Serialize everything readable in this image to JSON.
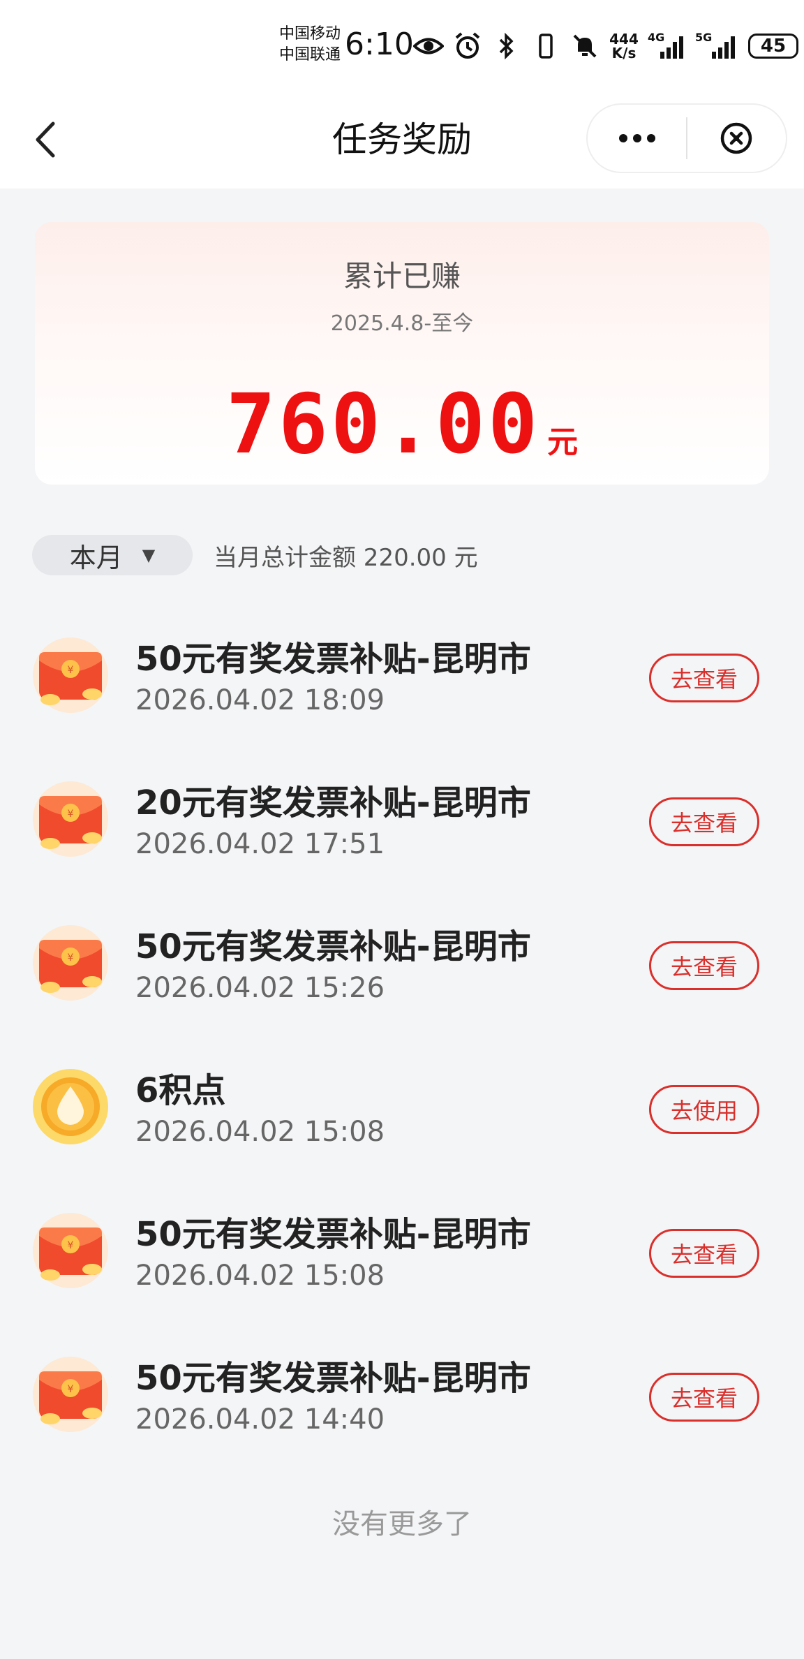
{
  "status_bar": {
    "carrier_1": "中国移动",
    "carrier_2": "中国联通",
    "time": "6:10",
    "net_speed_value": "444",
    "net_speed_unit": "K/s",
    "signal_1_label": "4G",
    "signal_2_label": "5G",
    "battery": "45",
    "icons": [
      "eye-icon",
      "alarm-icon",
      "bluetooth-icon",
      "vibrate-icon",
      "mute-icon",
      "charging-icon"
    ]
  },
  "nav": {
    "title": "任务奖励",
    "icons": [
      "back-arrow-icon",
      "more-dots-icon",
      "close-circle-icon"
    ]
  },
  "summary": {
    "title": "累计已赚",
    "date_range": "2025.4.8-至今",
    "amount": "760.00",
    "unit": "元",
    "accent_color": "#ee1111"
  },
  "filter": {
    "selected": "本月",
    "arrow": "▼",
    "month_total": "当月总计金额 220.00 元"
  },
  "items": [
    {
      "icon": "red-envelope-icon",
      "title": "50元有奖发票补贴-昆明市",
      "time": "2026.04.02 18:09",
      "action": "去查看"
    },
    {
      "icon": "red-envelope-icon",
      "title": "20元有奖发票补贴-昆明市",
      "time": "2026.04.02 17:51",
      "action": "去查看"
    },
    {
      "icon": "red-envelope-icon",
      "title": "50元有奖发票补贴-昆明市",
      "time": "2026.04.02 15:26",
      "action": "去查看"
    },
    {
      "icon": "points-drop-icon",
      "title": "6积点",
      "time": "2026.04.02 15:08",
      "action": "去使用"
    },
    {
      "icon": "red-envelope-icon",
      "title": "50元有奖发票补贴-昆明市",
      "time": "2026.04.02 15:08",
      "action": "去查看"
    },
    {
      "icon": "red-envelope-icon",
      "title": "50元有奖发票补贴-昆明市",
      "time": "2026.04.02 14:40",
      "action": "去查看"
    }
  ],
  "footer": {
    "no_more": "没有更多了"
  }
}
